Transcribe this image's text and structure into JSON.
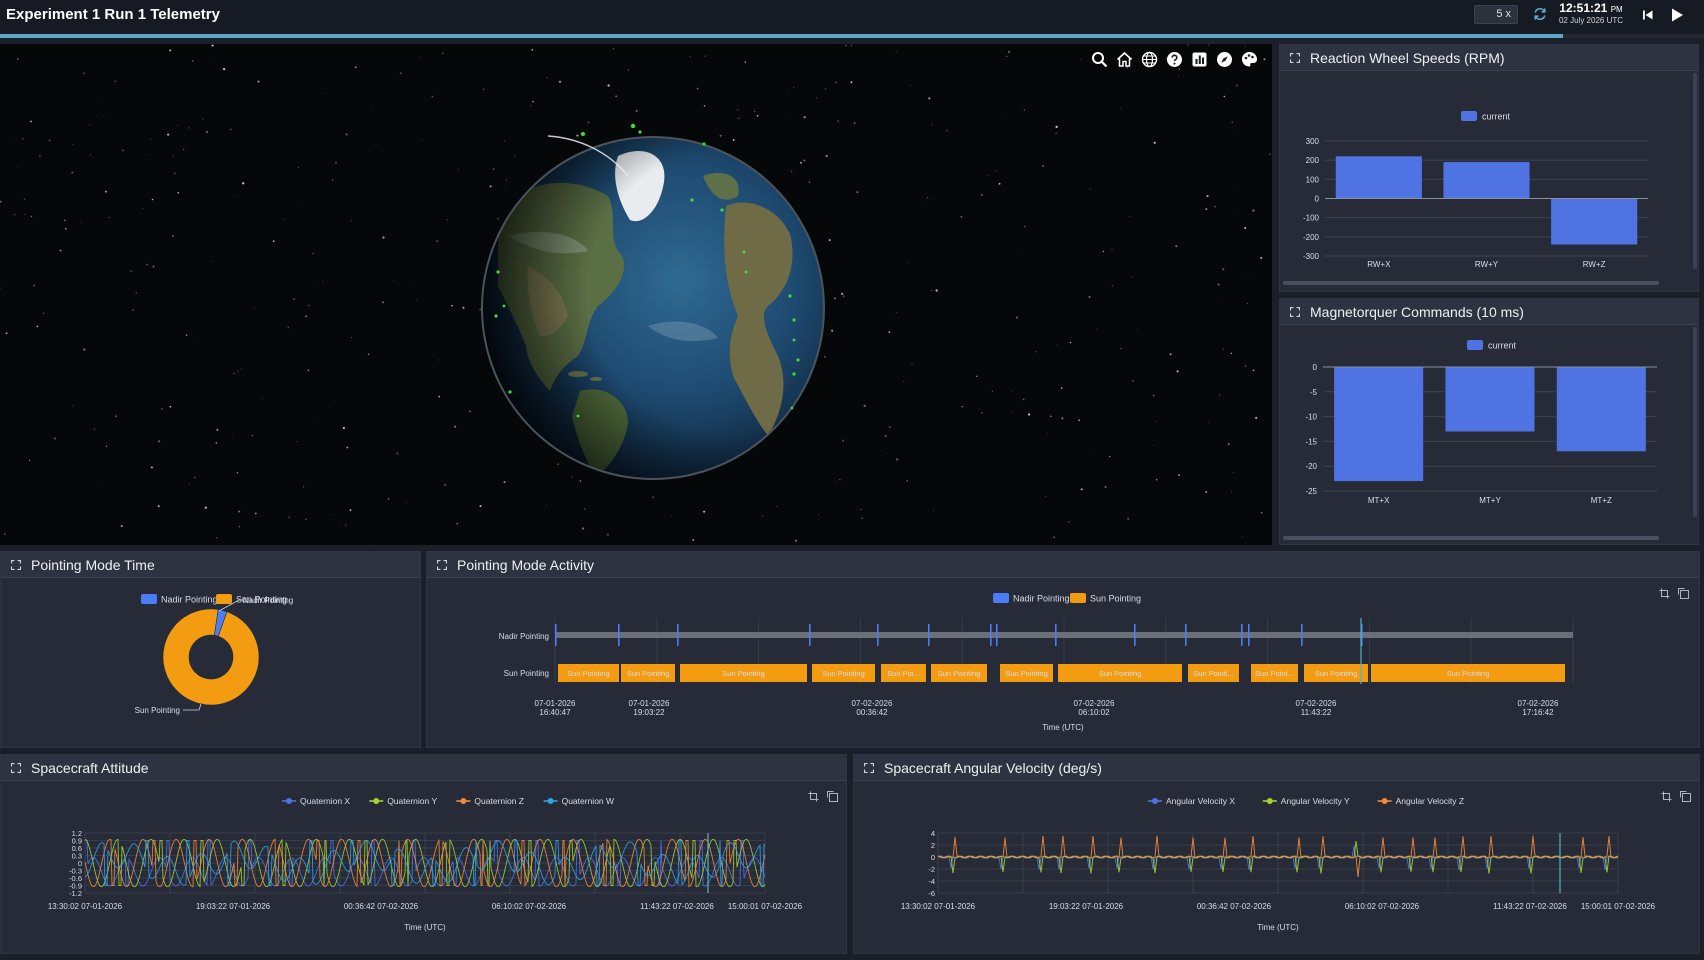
{
  "header": {
    "title": "Experiment 1 Run 1 Telemetry",
    "speed": "5 x",
    "time": "12:51:21",
    "ampm": "PM",
    "date": "02 July 2026 UTC",
    "playback_progress": 0.917
  },
  "viewer": {
    "toolbar_icons": [
      "search-icon",
      "home-icon",
      "globe-icon",
      "help-icon",
      "chart-icon",
      "compass-icon",
      "palette-icon"
    ]
  },
  "reaction_wheels": {
    "title": "Reaction Wheel Speeds (RPM)",
    "chart_data": {
      "type": "bar",
      "categories": [
        "RW+X",
        "RW+Y",
        "RW+Z"
      ],
      "series": [
        {
          "name": "current",
          "values": [
            220,
            190,
            -240
          ]
        }
      ],
      "yticks": [
        "300",
        "200",
        "100",
        "0",
        "-100",
        "-200",
        "-300"
      ],
      "ylim": [
        -300,
        300
      ],
      "color": "#4f73e3",
      "legend": "top-center"
    }
  },
  "magnetorquer": {
    "title": "Magnetorquer Commands (10 ms)",
    "chart_data": {
      "type": "bar",
      "categories": [
        "MT+X",
        "MT+Y",
        "MT+Z"
      ],
      "series": [
        {
          "name": "current",
          "values": [
            -23,
            -13,
            -17
          ]
        }
      ],
      "yticks": [
        "0",
        "-5",
        "-10",
        "-15",
        "-20",
        "-25"
      ],
      "ylim": [
        -25,
        0
      ],
      "color": "#4f73e3",
      "legend": "top-center"
    }
  },
  "pointing_time": {
    "title": "Pointing Mode Time",
    "chart_data": {
      "type": "pie",
      "labels": [
        "Nadir Pointing",
        "Sun Pointing"
      ],
      "values": [
        3,
        97
      ],
      "colors": [
        "#4b7ef5",
        "#f39c12"
      ],
      "slice_label_nadir": "Nadir Pointing",
      "slice_label_sun": "Sun Pointing"
    }
  },
  "pointing_activity": {
    "title": "Pointing Mode Activity",
    "legend": [
      "Nadir Pointing",
      "Sun Pointing"
    ],
    "rows": [
      "Nadir Pointing",
      "Sun Pointing"
    ],
    "xlabel": "Time (UTC)",
    "sun_labels": [
      "Sun Pointing",
      "Sun Pointing",
      "Sun Pointing",
      "Sun Pointing",
      "Sun Poi...",
      "Sun Pointing",
      "Sun Pointing",
      "Sun Pointing",
      "Sun Pointi...",
      "Sun Point...",
      "Sun Pointing",
      "Sun Pointing"
    ],
    "xticks": [
      {
        "line1": "07-01-2026",
        "line2": "16:40:47"
      },
      {
        "line1": "07-01-2026",
        "line2": "19:03:22"
      },
      {
        "line1": "07-02-2026",
        "line2": "00:36:42"
      },
      {
        "line1": "07-02-2026",
        "line2": "06:10:02"
      },
      {
        "line1": "07-02-2026",
        "line2": "11:43:22"
      },
      {
        "line1": "07-02-2026",
        "line2": "17:16:42"
      }
    ]
  },
  "attitude": {
    "title": "Spacecraft Attitude",
    "legend": [
      "Quaternion X",
      "Quaternion Y",
      "Quaternion Z",
      "Quaternion W"
    ],
    "colors": [
      "#4f73e3",
      "#a6d233",
      "#f5883a",
      "#33a3e6"
    ],
    "yticks": [
      "1.2",
      "0.9",
      "0.6",
      "0.3",
      "0",
      "-0.3",
      "-0.6",
      "-0.9",
      "-1.2"
    ],
    "xticks": [
      "13:30:02 07-01-2026",
      "19:03:22 07-01-2026",
      "00:36:42 07-02-2026",
      "06:10:02 07-02-2026",
      "11:43:22 07-02-2026",
      "15:00:01 07-02-2026"
    ],
    "xlabel": "Time (UTC)"
  },
  "angular_velocity": {
    "title": "Spacecraft Angular Velocity (deg/s)",
    "legend": [
      "Angular Velocity X",
      "Angular Velocity Y",
      "Angular Velocity Z"
    ],
    "colors": [
      "#4f73e3",
      "#a6d233",
      "#f5883a"
    ],
    "yticks": [
      "4",
      "2",
      "0",
      "-2",
      "-4",
      "-6"
    ],
    "xticks": [
      "13:30:02 07-01-2026",
      "19:03:22 07-01-2026",
      "00:36:42 07-02-2026",
      "06:10:02 07-02-2026",
      "11:43:22 07-02-2026",
      "15:00:01 07-02-2026"
    ],
    "xlabel": "Time (UTC)"
  }
}
